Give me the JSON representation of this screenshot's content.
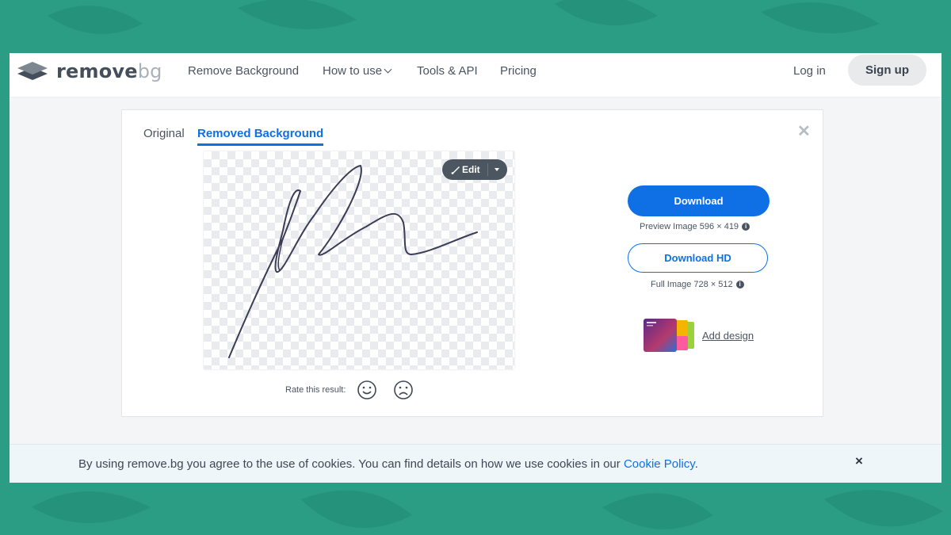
{
  "brand": {
    "name_main": "remove",
    "name_suffix": "bg",
    "colors": {
      "text": "#454f5b",
      "suffix": "#a9b1b9",
      "accent": "#0f70e6",
      "page_bg": "#2a9d84"
    }
  },
  "nav": {
    "items": [
      {
        "label": "Remove Background",
        "has_dropdown": false
      },
      {
        "label": "How to use",
        "has_dropdown": true
      },
      {
        "label": "Tools & API",
        "has_dropdown": false
      },
      {
        "label": "Pricing",
        "has_dropdown": false
      }
    ],
    "login_label": "Log in",
    "signup_label": "Sign up"
  },
  "editor": {
    "tabs": [
      {
        "label": "Original",
        "active": false
      },
      {
        "label": "Removed Background",
        "active": true
      }
    ],
    "close_symbol": "✕",
    "edit_label": "Edit",
    "rate_label": "Rate this result:"
  },
  "downloads": {
    "download_label": "Download",
    "preview_info": "Preview Image 596 × 419",
    "download_hd_label": "Download HD",
    "full_info": "Full Image 728 × 512",
    "add_design_label": "Add design"
  },
  "cookie": {
    "text_before": "By using remove.bg you agree to the use of cookies. You can find details on how we use cookies in our ",
    "link_label": "Cookie Policy",
    "text_after": ".",
    "close_symbol": "×"
  }
}
